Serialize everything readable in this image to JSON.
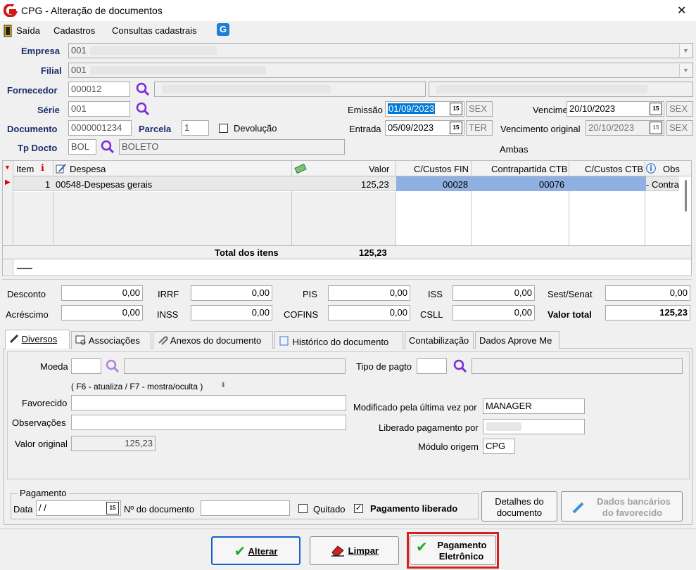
{
  "window": {
    "title": "CPG - Alteração de documentos",
    "close": "✕"
  },
  "menu": [
    "Saída",
    "Cadastros",
    "Consultas cadastrais"
  ],
  "header": {
    "empresa": {
      "label": "Empresa",
      "value": "001"
    },
    "filial": {
      "label": "Filial",
      "value": "001"
    },
    "fornecedor": {
      "label": "Fornecedor",
      "value": "000012"
    },
    "serie": {
      "label": "Série",
      "value": "001"
    },
    "documento": {
      "label": "Documento",
      "value": "0000001234"
    },
    "parcela": {
      "label": "Parcela",
      "value": "1"
    },
    "devolucao": {
      "label": "Devolução",
      "checked": false
    },
    "tp_docto": {
      "label": "Tp Docto",
      "value": "BOL",
      "desc": "BOLETO"
    },
    "emissao": {
      "label": "Emissão",
      "value": "01/09/2023",
      "day": "SEX"
    },
    "entrada": {
      "label": "Entrada",
      "value": "05/09/2023",
      "day": "TER"
    },
    "vencimento": {
      "label": "Vencimento",
      "value": "20/10/2023",
      "day": "SEX"
    },
    "vencimento_original": {
      "label": "Vencimento original",
      "value": "20/10/2023",
      "day": "SEX"
    },
    "ambas": "Ambas"
  },
  "grid": {
    "columns": [
      "Item",
      "Despesa",
      "Valor",
      "C/Custos FIN",
      "Contrapartida CTB",
      "C/Custos CTB",
      "Obs"
    ],
    "rows": [
      {
        "item": "1",
        "despesa": "00548-Despesas gerais",
        "valor": "125,23",
        "ccfin": "00028",
        "contrapartida": "00076",
        "ccctb": "",
        "obs": "- Contra"
      }
    ],
    "total_label": "Total dos itens",
    "total_value": "125,23"
  },
  "totals": {
    "desconto": {
      "label": "Desconto",
      "value": "0,00"
    },
    "irrf": {
      "label": "IRRF",
      "value": "0,00"
    },
    "pis": {
      "label": "PIS",
      "value": "0,00"
    },
    "iss": {
      "label": "ISS",
      "value": "0,00"
    },
    "sest": {
      "label": "Sest/Senat",
      "value": "0,00"
    },
    "acrescimo": {
      "label": "Acréscimo",
      "value": "0,00"
    },
    "inss": {
      "label": "INSS",
      "value": "0,00"
    },
    "cofins": {
      "label": "COFINS",
      "value": "0,00"
    },
    "csll": {
      "label": "CSLL",
      "value": "0,00"
    },
    "valor_total": {
      "label": "Valor total",
      "value": "125,23"
    }
  },
  "tabs": [
    "Diversos",
    "Associações",
    "Anexos do documento",
    "Histórico do documento",
    "Contabilização",
    "Dados Aprove Me"
  ],
  "diversos": {
    "moeda": "Moeda",
    "hint": "( F6 - atualiza / F7 - mostra/oculta )",
    "tipo_pagto": "Tipo de pagto",
    "favorecido": "Favorecido",
    "observacoes": "Observações",
    "valor_original": {
      "label": "Valor original",
      "value": "125,23"
    },
    "modificado": {
      "label": "Modificado pela última vez por",
      "value": "MANAGER"
    },
    "liberado": {
      "label": "Liberado pagamento por"
    },
    "modulo": {
      "label": "Módulo origem",
      "value": "CPG"
    }
  },
  "pagamento": {
    "group": "Pagamento",
    "data_label": "Data",
    "data_value": " /  /",
    "nro_label": "Nº do documento",
    "quitado": "Quitado",
    "liberado": "Pagamento liberado",
    "detalhes_line1": "Detalhes do",
    "detalhes_line2": "documento",
    "dados_line1": "Dados bancários",
    "dados_line2": "do favorecido"
  },
  "buttons": {
    "alterar": "Alterar",
    "limpar": "Limpar",
    "pag_line1": "Pagamento",
    "pag_line2": "Eletrônico"
  },
  "colors": {
    "accent": "#1a2e6e",
    "highlight": "#8fb0e0",
    "selected_text": "#0b4fd6",
    "red_frame": "#d81e1e"
  }
}
